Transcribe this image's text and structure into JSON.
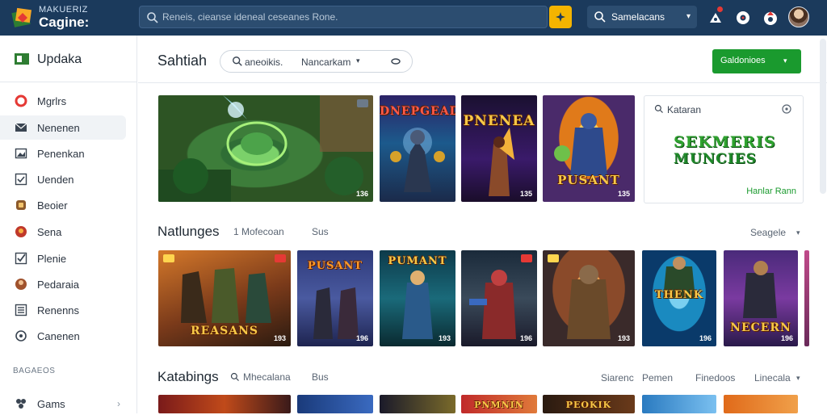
{
  "brand": {
    "line1": "MAKUERIZ",
    "line2": "Cagine:"
  },
  "top_search": {
    "placeholder": "Reneis, cieanse ideneal ceseanes Rone."
  },
  "top_filter": {
    "label": "Samelacans"
  },
  "sidebar": {
    "header": "Updaka",
    "items": [
      {
        "label": "Mgrlrs",
        "icon": "ring-icon",
        "active": false
      },
      {
        "label": "Nenenen",
        "icon": "mail-icon",
        "active": true
      },
      {
        "label": "Penenkan",
        "icon": "image-icon",
        "active": false
      },
      {
        "label": "Uenden",
        "icon": "checkbox-icon",
        "active": false
      },
      {
        "label": "Beoier",
        "icon": "shield-icon",
        "active": false
      },
      {
        "label": "Sena",
        "icon": "globe-icon",
        "active": false
      },
      {
        "label": "Plenie",
        "icon": "check-icon",
        "active": false
      },
      {
        "label": "Pedaraia",
        "icon": "avatar-icon",
        "active": false
      },
      {
        "label": "Renenns",
        "icon": "list-icon",
        "active": false
      },
      {
        "label": "Canenen",
        "icon": "circle-icon",
        "active": false
      }
    ],
    "section_label": "BAGAEOS",
    "games_label": "Gams"
  },
  "main": {
    "title": "Sahtiah",
    "search": {
      "text1": "aneoikis.",
      "text2": "Nancarkam"
    },
    "cta_label": "Galdonioes"
  },
  "featured": {
    "tiles": [
      {
        "tag": "136"
      },
      {
        "title": "DNEPGEAD",
        "tag": ""
      },
      {
        "title": "PNENEA",
        "tag": "135"
      },
      {
        "title": "PUSANT",
        "tag": "135"
      }
    ],
    "promo": {
      "search_text": "Kataran",
      "logo_line1": "SEKMERIS",
      "logo_line2": "MUNCIES",
      "link": "Hanlar Rann"
    }
  },
  "section1": {
    "title": "Natlunges",
    "sub1": "1 Mofecoan",
    "sub2": "Sus",
    "sort": "Seagele",
    "tiles": [
      {
        "title": "REASANS",
        "tag": "193"
      },
      {
        "title": "PUSANT",
        "tag": "196"
      },
      {
        "title": "PUMANT",
        "tag": "193"
      },
      {
        "title": "",
        "tag": "196"
      },
      {
        "title": "",
        "tag": "193"
      },
      {
        "title": "THENK",
        "tag": "196"
      },
      {
        "title": "NECERN",
        "tag": "196"
      }
    ]
  },
  "section2": {
    "title": "Katabings",
    "sub1": "Mhecalana",
    "sub2": "Bus",
    "ctrl1": "Siarenc",
    "ctrl2": "Pemen",
    "ctrl3": "Finedoos",
    "ctrl4": "Linecala",
    "tiles": [
      {
        "title": ""
      },
      {
        "title": ""
      },
      {
        "title": ""
      },
      {
        "title": "PNMNIN"
      },
      {
        "title": "PEOKIK"
      },
      {
        "title": ""
      },
      {
        "title": ""
      }
    ]
  },
  "colors": {
    "topbar": "#1b3a5c",
    "accent_green": "#1a9a2e",
    "search_button": "#f4b400"
  }
}
